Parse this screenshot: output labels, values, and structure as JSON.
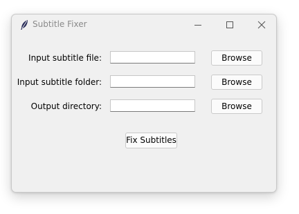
{
  "window": {
    "title": "Subtitle Fixer",
    "icon": "feather-icon"
  },
  "rows": [
    {
      "label": "Input subtitle file:",
      "value": "",
      "button": "Browse"
    },
    {
      "label": "Input subtitle folder:",
      "value": "",
      "button": "Browse"
    },
    {
      "label": "Output directory:",
      "value": "",
      "button": "Browse"
    }
  ],
  "actions": {
    "fix_label": "Fix Subtitles"
  }
}
